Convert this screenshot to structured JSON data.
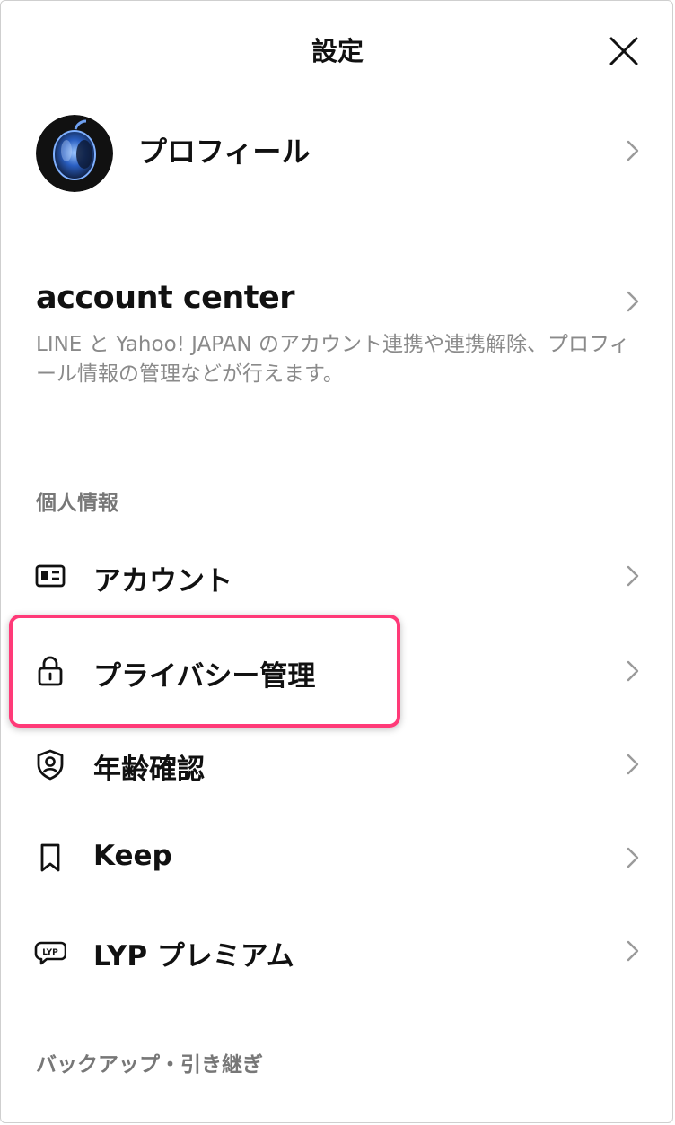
{
  "header": {
    "title": "設定"
  },
  "profile": {
    "label": "プロフィール"
  },
  "account_center": {
    "title": "account center",
    "description": "LINE と Yahoo! JAPAN のアカウント連携や連携解除、プロフィール情報の管理などが行えます。"
  },
  "sections": {
    "personal": "個人情報",
    "backup": "バックアップ・引き継ぎ"
  },
  "items": [
    {
      "label": "アカウント",
      "icon": "id-card-icon"
    },
    {
      "label": "プライバシー管理",
      "icon": "lock-icon"
    },
    {
      "label": "年齢確認",
      "icon": "shield-person-icon"
    },
    {
      "label": "Keep",
      "icon": "bookmark-icon"
    },
    {
      "label": "LYP プレミアム",
      "icon": "lyp-badge-icon"
    }
  ],
  "colors": {
    "highlight": "#ff3a78",
    "muted": "#8a8a8a",
    "section": "#777777"
  }
}
